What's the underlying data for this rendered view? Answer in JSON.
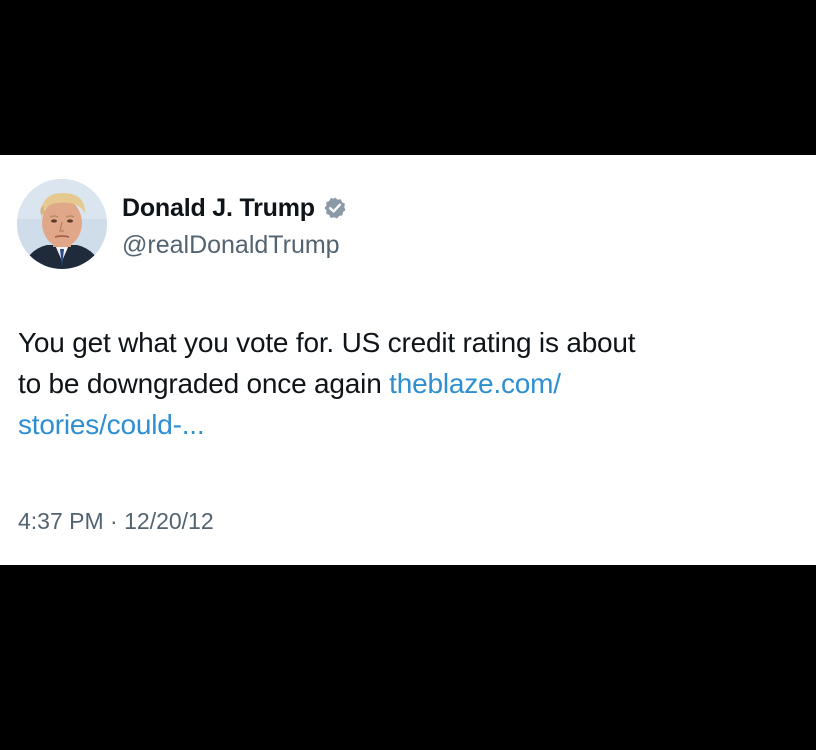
{
  "tweet": {
    "author": {
      "display_name": "Donald J. Trump",
      "handle": "@realDonaldTrump",
      "verified": true,
      "verified_icon": "verified-badge-icon",
      "badge_color": "#8b98a5"
    },
    "text": {
      "line1": "You get what you vote for.  US credit rating is about",
      "line2_plain": "to be downgraded once again ",
      "link_part1": "theblaze.com/",
      "link_part2": "stories/could-..."
    },
    "timestamp": {
      "time": "4:37 PM",
      "separator": " · ",
      "date": "12/20/12"
    },
    "colors": {
      "background": "#ffffff",
      "text": "#0f1419",
      "secondary": "#536471",
      "link": "#2f8fd1",
      "frame": "#000000"
    }
  }
}
